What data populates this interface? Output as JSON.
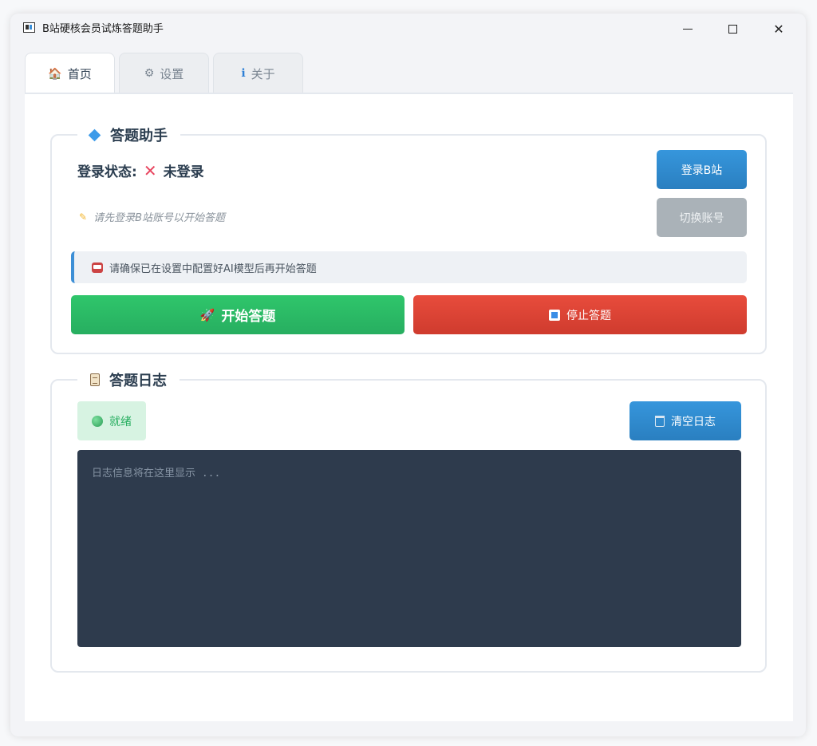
{
  "window": {
    "title": "B站硬核会员试炼答题助手",
    "controls": {
      "minimize": "minimize-icon",
      "maximize": "maximize-icon",
      "close": "✕"
    }
  },
  "tabs": [
    {
      "label": "首页",
      "icon": "🏠",
      "active": true
    },
    {
      "label": "设置",
      "icon": "⚙",
      "active": false
    },
    {
      "label": "关于",
      "icon": "ℹ",
      "active": false
    }
  ],
  "assistant": {
    "title": "答题助手",
    "login_label": "登录状态:",
    "login_icon": "✕",
    "login_value": "未登录",
    "hint": "请先登录B站账号以开始答题",
    "login_button": "登录B站",
    "switch_button": "切换账号",
    "notice": "请确保已在设置中配置好AI模型后再开始答题",
    "start_button": "开始答题",
    "start_icon": "🚀",
    "stop_button": "停止答题"
  },
  "log": {
    "title": "答题日志",
    "status": "就绪",
    "clear_button": "清空日志",
    "placeholder": "日志信息将在这里显示 ..."
  },
  "colors": {
    "primary": "#2a7fc0",
    "success": "#27ae60",
    "danger": "#e74c3c",
    "disabled": "#aab2b8",
    "log_bg": "#2e3b4d"
  }
}
